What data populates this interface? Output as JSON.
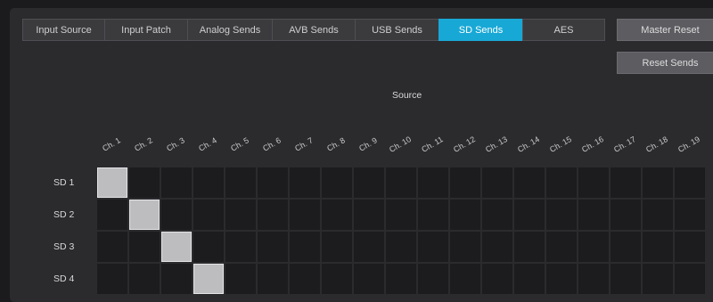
{
  "tabs": [
    {
      "label": "Input Source",
      "active": false
    },
    {
      "label": "Input Patch",
      "active": false
    },
    {
      "label": "Analog Sends",
      "active": false
    },
    {
      "label": "AVB Sends",
      "active": false
    },
    {
      "label": "USB Sends",
      "active": false
    },
    {
      "label": "SD Sends",
      "active": true
    },
    {
      "label": "AES",
      "active": false
    }
  ],
  "buttons": {
    "master_reset": "Master Reset",
    "reset_sends": "Reset Sends"
  },
  "matrix": {
    "source_title": "Source",
    "columns": [
      "Ch. 1",
      "Ch. 2",
      "Ch. 3",
      "Ch. 4",
      "Ch. 5",
      "Ch. 6",
      "Ch. 7",
      "Ch. 8",
      "Ch. 9",
      "Ch. 10",
      "Ch. 11",
      "Ch. 12",
      "Ch. 13",
      "Ch. 14",
      "Ch. 15",
      "Ch. 16",
      "Ch. 17",
      "Ch. 18",
      "Ch. 19"
    ],
    "rows": [
      "SD 1",
      "SD 2",
      "SD 3",
      "SD 4"
    ],
    "routed": [
      [
        0,
        0
      ],
      [
        1,
        1
      ],
      [
        2,
        2
      ],
      [
        3,
        3
      ]
    ]
  },
  "colors": {
    "accent": "#18a8d6",
    "panel": "#2b2b2e",
    "cell_off": "#1c1c1e",
    "cell_on": "#bdbdbf"
  }
}
